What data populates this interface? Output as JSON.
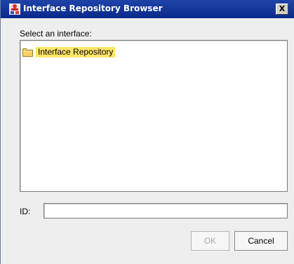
{
  "window": {
    "title": "Interface Repository Browser",
    "close_glyph": "X",
    "titlebar_color": "#0a2a8a"
  },
  "main": {
    "select_label": "Select an interface:",
    "tree": {
      "root_label": "Interface Repository",
      "root_icon": "folder-icon",
      "selected_highlight": "#ffe566"
    },
    "id_label": "ID:",
    "id_value": ""
  },
  "buttons": {
    "ok_label": "OK",
    "ok_enabled": false,
    "cancel_label": "Cancel"
  }
}
